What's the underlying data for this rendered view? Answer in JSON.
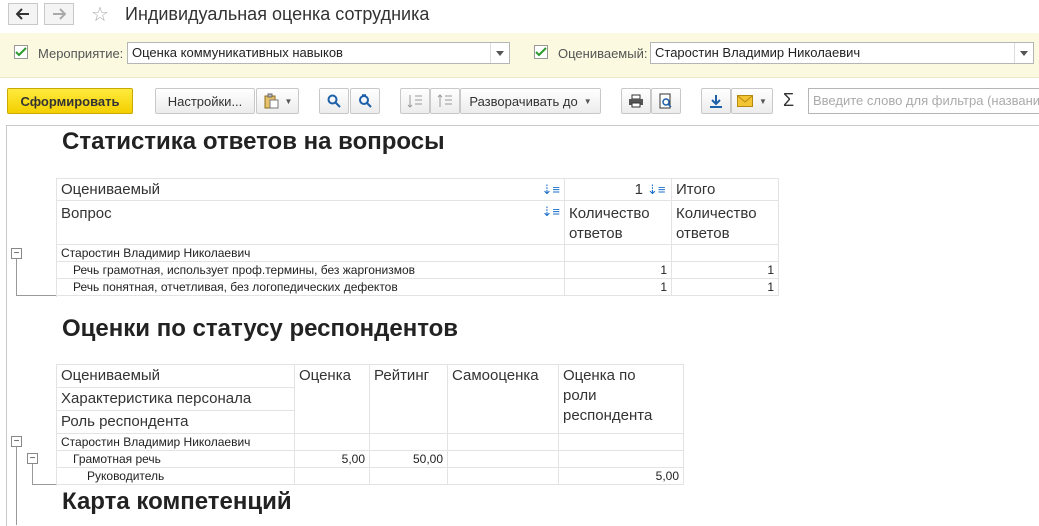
{
  "title": "Индивидуальная оценка сотрудника",
  "params": {
    "event_label": "Мероприятие:",
    "event_value": "Оценка коммуникативных навыков",
    "evaluated_label": "Оцениваемый:",
    "evaluated_value": "Старостин Владимир Николаевич"
  },
  "toolbar": {
    "generate": "Сформировать",
    "settings": "Настройки...",
    "expand_to": "Разворачивать до",
    "filter_placeholder": "Введите слово для фильтра (название"
  },
  "section1": {
    "title": "Статистика ответов на вопросы",
    "header": {
      "evaluated": "Оцениваемый",
      "question": "Вопрос",
      "col1_top": "1",
      "col1_label_a": "Количество",
      "col1_label_b": "ответов",
      "total": "Итого",
      "total_label_a": "Количество",
      "total_label_b": "ответов"
    },
    "group": "Старостин Владимир Николаевич",
    "rows": [
      {
        "name": "Речь грамотная, использует проф.термины, без жаргонизмов",
        "v1": "1",
        "total": "1"
      },
      {
        "name": "Речь понятная, отчетливая, без логопедических дефектов",
        "v1": "1",
        "total": "1"
      }
    ]
  },
  "section2": {
    "title": "Оценки по статусу респондентов",
    "header": {
      "evaluated": "Оцениваемый",
      "characteristic": "Характеристика персонала",
      "role": "Роль респондента",
      "score": "Оценка",
      "rating": "Рейтинг",
      "self": "Самооценка",
      "role_score_a": "Оценка по",
      "role_score_b": "роли",
      "role_score_c": "респондента"
    },
    "group": "Старостин Владимир Николаевич",
    "subgroup": {
      "name": "Грамотная речь",
      "score": "5,00",
      "rating": "50,00"
    },
    "leaf": {
      "name": "Руководитель",
      "role_score": "5,00"
    }
  },
  "section3": {
    "title": "Карта компетенций"
  }
}
